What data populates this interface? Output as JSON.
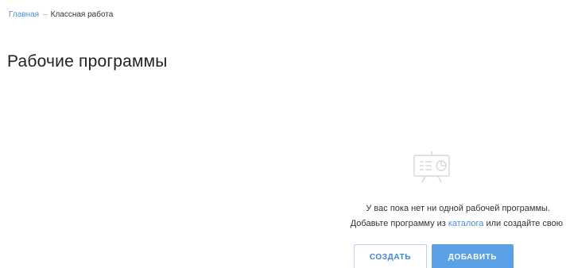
{
  "breadcrumb": {
    "home": "Главная",
    "separator": "–",
    "current": "Классная работа"
  },
  "page": {
    "title": "Рабочие программы"
  },
  "empty_state": {
    "icon": "presentation-board-icon",
    "line1": "У вас пока нет ни одной рабочей программы.",
    "line2_prefix": "Добавьте программу из",
    "line2_link": "каталога",
    "line2_suffix": "или создайте свою"
  },
  "actions": {
    "create_label": "СОЗДАТЬ",
    "add_label": "ДОБАВИТЬ"
  },
  "colors": {
    "accent": "#4a90d9",
    "primary_button": "#5aa1e6"
  }
}
